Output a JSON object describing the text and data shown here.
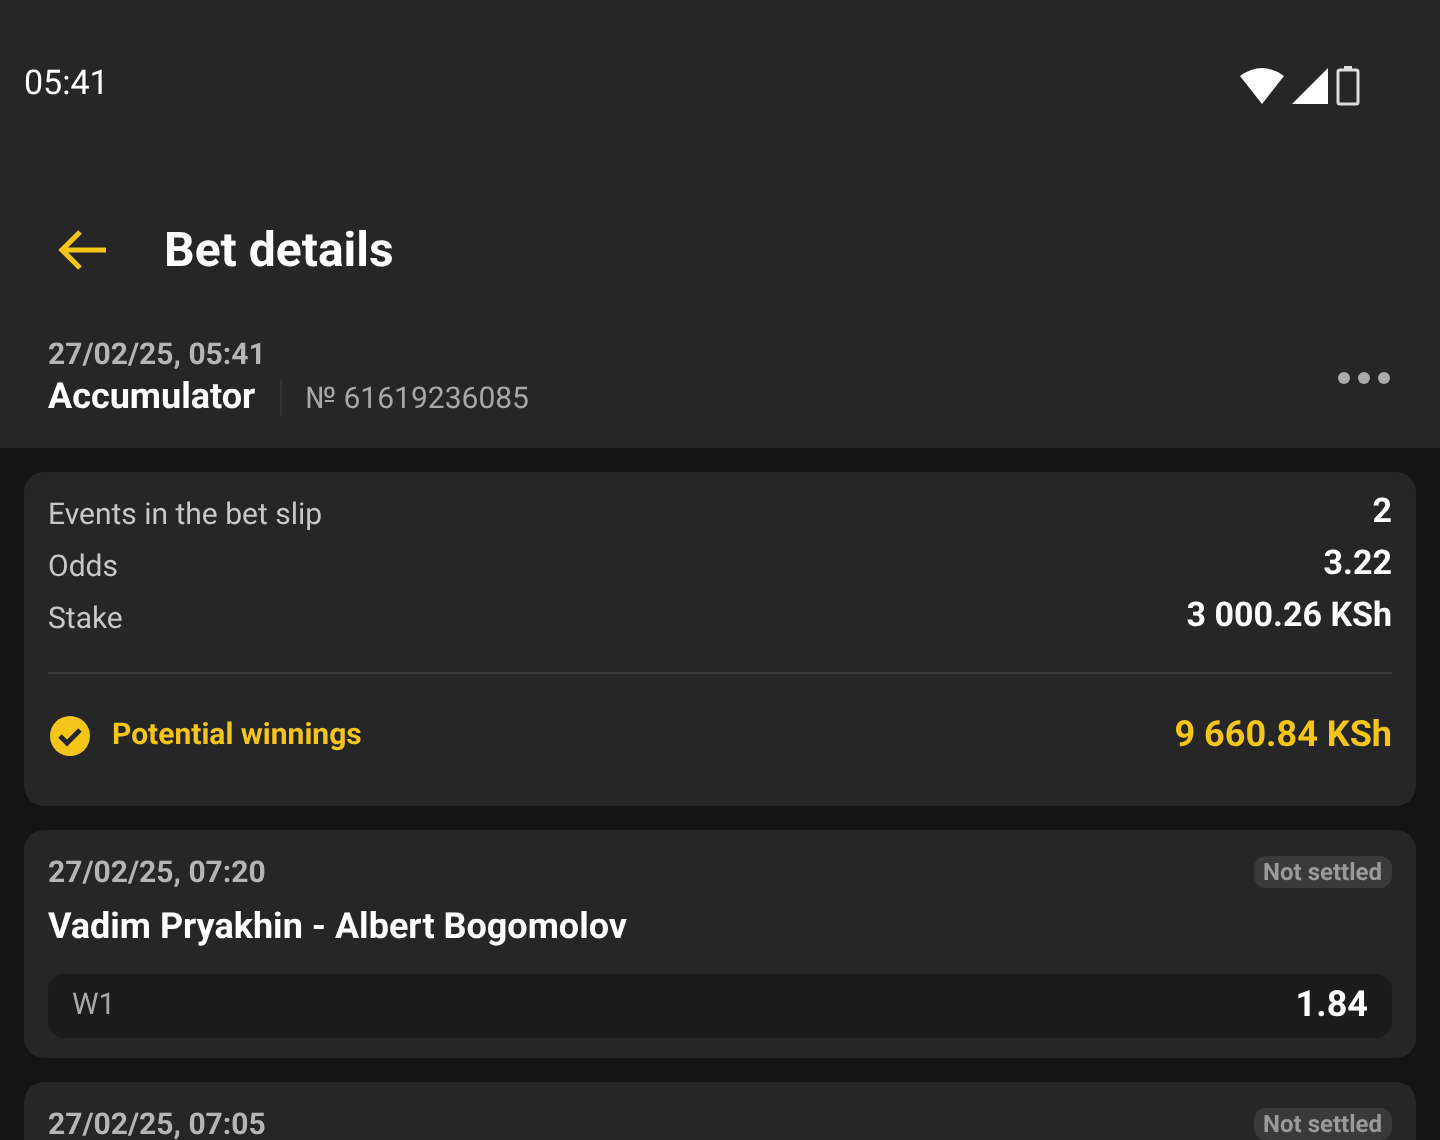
{
  "status_bar": {
    "time": "05:41"
  },
  "header": {
    "title": "Bet details"
  },
  "bet": {
    "date": "27/02/25, 05:41",
    "type": "Accumulator",
    "number": "№ 61619236085"
  },
  "summary": {
    "rows": [
      {
        "label": "Events in the bet slip",
        "value": "2"
      },
      {
        "label": "Odds",
        "value": "3.22"
      },
      {
        "label": "Stake",
        "value": "3 000.26 KSh"
      }
    ],
    "winnings": {
      "label": "Potential winnings",
      "value": "9 660.84 KSh"
    }
  },
  "events": [
    {
      "date": "27/02/25, 07:20",
      "status": "Not settled",
      "title": "Vadim Pryakhin - Albert Bogomolov",
      "outcome": "W1",
      "odds": "1.84"
    },
    {
      "date": "27/02/25, 07:05",
      "status": "Not settled"
    }
  ]
}
